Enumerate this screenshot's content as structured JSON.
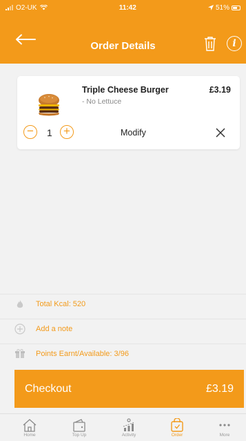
{
  "status_bar": {
    "carrier": "O2-UK",
    "time": "11:42",
    "battery": "51%"
  },
  "header": {
    "title": "Order Details"
  },
  "order_item": {
    "name": "Triple Cheese Burger",
    "modifier": "- No Lettuce",
    "price": "£3.19",
    "quantity": "1",
    "minus_label": "−",
    "plus_label": "+",
    "modify_label": "Modify"
  },
  "info_rows": {
    "kcal": "Total Kcal: 520",
    "note": "Add a note",
    "points": "Points Earnt/Available: 3/96"
  },
  "checkout": {
    "label": "Checkout",
    "total": "£3.19"
  },
  "tabs": [
    {
      "label": "Home",
      "icon": "home-icon"
    },
    {
      "label": "Top Up",
      "icon": "wallet-icon"
    },
    {
      "label": "Activity",
      "icon": "activity-icon"
    },
    {
      "label": "Order",
      "icon": "shopping-bag-icon"
    },
    {
      "label": "More",
      "icon": "more-icon"
    }
  ],
  "colors": {
    "accent": "#f39a1a",
    "background": "#f2f2f2"
  }
}
